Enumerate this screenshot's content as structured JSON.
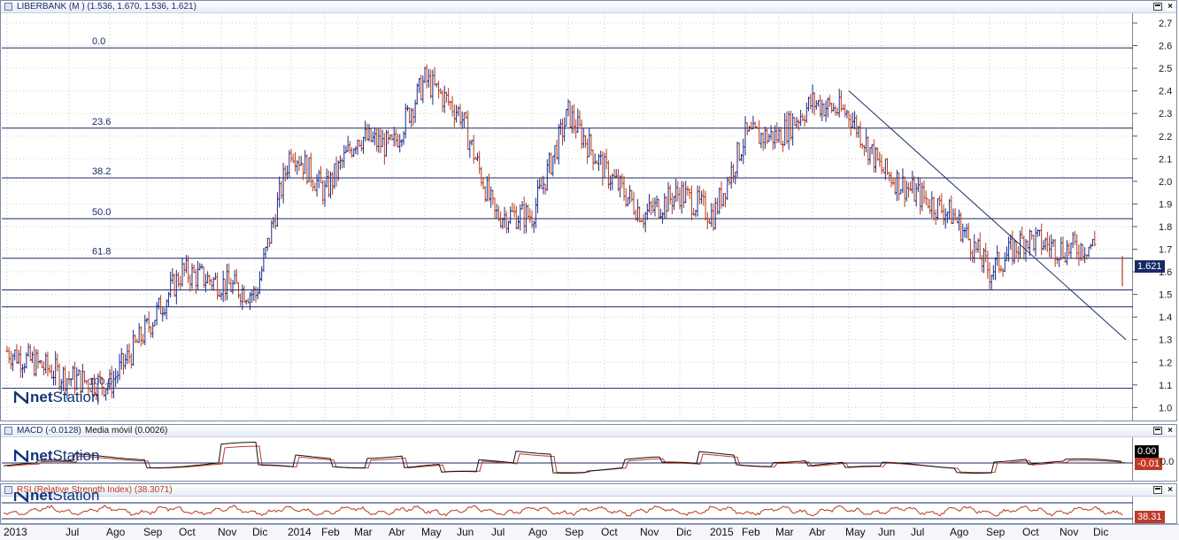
{
  "main_panel": {
    "title": "LIBERBANK (M )",
    "ohlc": "(1.536, 1.670, 1.536, 1.621)",
    "last_value_badge": "1.621",
    "y_ticks": [
      "2.7",
      "2.6",
      "2.5",
      "2.4",
      "2.3",
      "2.2",
      "2.1",
      "2.0",
      "1.9",
      "1.8",
      "1.7",
      "1.6",
      "1.5",
      "1.4",
      "1.3",
      "1.2",
      "1.1",
      "1.0"
    ],
    "fib_levels": [
      {
        "label": "0.0",
        "price": 2.59
      },
      {
        "label": "23.6",
        "price": 2.235
      },
      {
        "label": "38.2",
        "price": 2.015
      },
      {
        "label": "50.0",
        "price": 1.835
      },
      {
        "label": "61.8",
        "price": 1.66
      },
      {
        "label": "100.0",
        "price": 1.085
      }
    ],
    "extra_h_lines": [
      1.52,
      1.445
    ],
    "colors": {
      "up": "#1a2a88",
      "down": "#b83a1a",
      "line": "#1a2a66"
    }
  },
  "macd_panel": {
    "title": "MACD (-0.0128)",
    "ma_label": "Media móvil (0.0026)",
    "zero_label": "0.0",
    "badge_black": "0.00",
    "badge_red": "-0.01"
  },
  "rsi_panel": {
    "title": "RSI (Relative Strength Index) (38.3071)",
    "badge": "38.31"
  },
  "watermark": {
    "brand_bold": "net",
    "brand_rest": "Station"
  },
  "x_axis": {
    "labels": [
      "2013",
      "Jul",
      "Ago",
      "Sep",
      "Oct",
      "Nov",
      "Dic",
      "2014",
      "Feb",
      "Mar",
      "Abr",
      "May",
      "Jun",
      "Jul",
      "Ago",
      "Sep",
      "Oct",
      "Nov",
      "Dic",
      "2015",
      "Feb",
      "Mar",
      "Abr",
      "May",
      "Jun",
      "Jul",
      "Ago",
      "Sep",
      "Oct",
      "Nov",
      "Dic"
    ]
  },
  "chart_data": {
    "type": "ohlc",
    "title": "LIBERBANK (M )",
    "ylim": [
      0.95,
      2.75
    ],
    "x": [
      "2013-06",
      "2013-07",
      "2013-08",
      "2013-09",
      "2013-10",
      "2013-11",
      "2013-12",
      "2014-01",
      "2014-02",
      "2014-03",
      "2014-04",
      "2014-05",
      "2014-06",
      "2014-07",
      "2014-08",
      "2014-09",
      "2014-10",
      "2014-11",
      "2014-12",
      "2015-01",
      "2015-02",
      "2015-03",
      "2015-04",
      "2015-05",
      "2015-06",
      "2015-07",
      "2015-08",
      "2015-09",
      "2015-10",
      "2015-11",
      "2015-12"
    ],
    "close_approx": [
      1.25,
      1.13,
      1.1,
      1.35,
      1.6,
      1.55,
      1.5,
      2.15,
      1.95,
      2.2,
      2.15,
      2.45,
      2.3,
      1.85,
      1.85,
      2.3,
      2.05,
      1.85,
      1.95,
      1.85,
      2.2,
      2.2,
      2.35,
      2.3,
      2.05,
      1.95,
      1.85,
      1.6,
      1.75,
      1.7,
      1.72
    ],
    "trendline": {
      "from_price": 2.4,
      "from_month": "2015-05",
      "to_price": 1.3,
      "to_month": "2015-12"
    },
    "last": {
      "open": 1.536,
      "high": 1.67,
      "low": 1.536,
      "close": 1.621
    }
  }
}
